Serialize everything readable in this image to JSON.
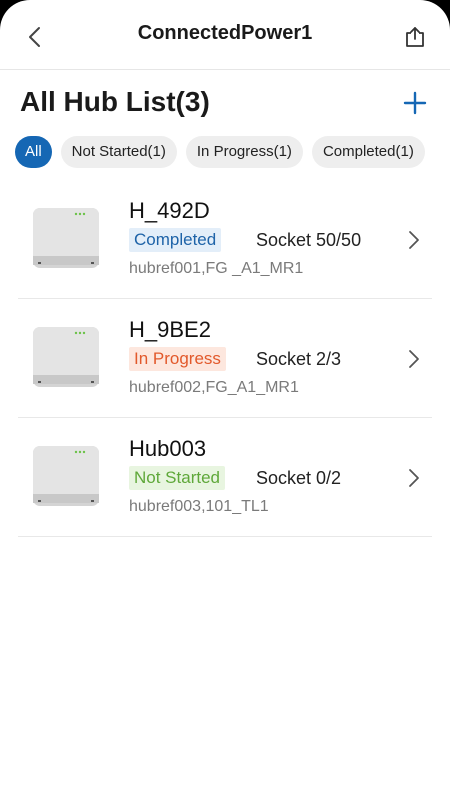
{
  "header": {
    "title": "ConnectedPower1",
    "back_icon": "chevron-left-icon",
    "share_icon": "share-icon"
  },
  "page": {
    "title": "All Hub List(3)",
    "add_icon": "plus-icon"
  },
  "filters": [
    {
      "label": "All",
      "active": true
    },
    {
      "label": "Not Started(1)",
      "active": false
    },
    {
      "label": "In Progress(1)",
      "active": false
    },
    {
      "label": "Completed(1)",
      "active": false
    }
  ],
  "hubs": [
    {
      "name": "H_492D",
      "status": "Completed",
      "socket": "Socket 50/50",
      "ref": "hubref001,FG _A1_MR1"
    },
    {
      "name": "H_9BE2",
      "status": "In Progress",
      "socket": "Socket 2/3",
      "ref": "hubref002,FG_A1_MR1"
    },
    {
      "name": "Hub003",
      "status": "Not Started",
      "socket": "Socket 0/2",
      "ref": "hubref003,101_TL1"
    }
  ],
  "colors": {
    "accent": "#1567b4",
    "completed_text": "#1e63a8",
    "completed_bg": "#e3eef9",
    "inprogress_text": "#e2592b",
    "inprogress_bg": "#fde7de",
    "notstarted_text": "#5fa83a",
    "notstarted_bg": "#e8f5e0"
  }
}
